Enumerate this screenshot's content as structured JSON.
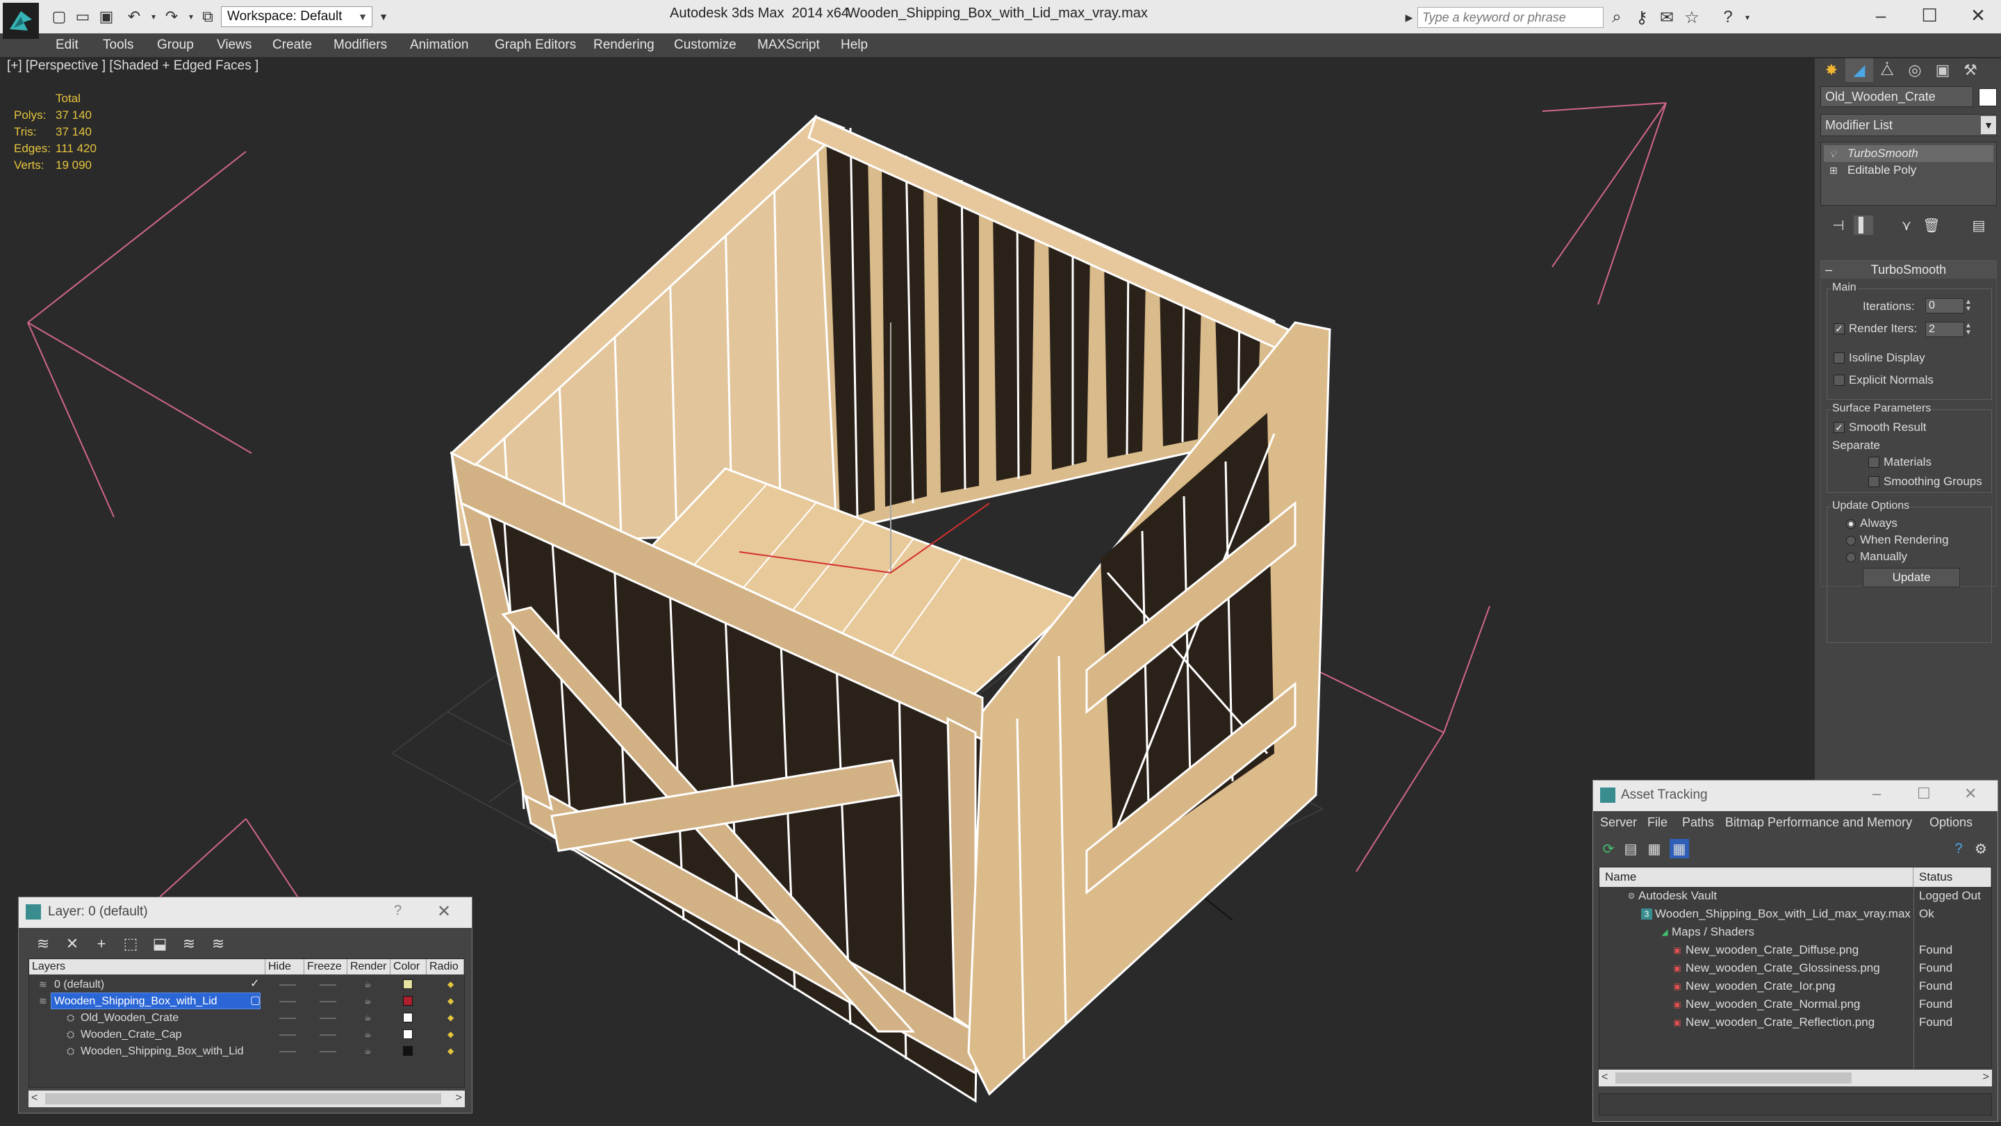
{
  "titlebar": {
    "workspace": "Workspace: Default",
    "app_title": "Autodesk 3ds Max  2014 x64",
    "file_name": "Wooden_Shipping_Box_with_Lid_max_vray.max",
    "search_placeholder": "Type a keyword or phrase"
  },
  "menu": [
    "Edit",
    "Tools",
    "Group",
    "Views",
    "Create",
    "Modifiers",
    "Animation",
    "Graph Editors",
    "Rendering",
    "Customize",
    "MAXScript",
    "Help"
  ],
  "viewport": {
    "label": "[+] [Perspective ] [Shaded + Edged Faces ]",
    "stats_header": "Total",
    "stats": [
      {
        "k": "Polys:",
        "v": "37 140"
      },
      {
        "k": "Tris:",
        "v": "37 140"
      },
      {
        "k": "Edges:",
        "v": "111 420"
      },
      {
        "k": "Verts:",
        "v": "19 090"
      }
    ]
  },
  "command_panel": {
    "object_name": "Old_Wooden_Crate",
    "modifier_list": "Modifier List",
    "stack": [
      "TurboSmooth",
      "Editable Poly"
    ],
    "rollout_title": "TurboSmooth",
    "main_group": "Main",
    "iterations_label": "Iterations:",
    "iterations_value": "0",
    "render_iters_label": "Render Iters:",
    "render_iters_value": "2",
    "isoline_label": "Isoline Display",
    "explicit_normals_label": "Explicit Normals",
    "surface_group": "Surface Parameters",
    "smooth_result_label": "Smooth Result",
    "separate_label": "Separate",
    "materials_label": "Materials",
    "smoothing_groups_label": "Smoothing Groups",
    "update_group": "Update Options",
    "always_label": "Always",
    "when_rendering_label": "When Rendering",
    "manually_label": "Manually",
    "update_button": "Update"
  },
  "layer_dialog": {
    "title": "Layer: 0 (default)",
    "help": "?",
    "columns": [
      "Layers",
      "Hide",
      "Freeze",
      "Render",
      "Color",
      "Radio"
    ],
    "rows": [
      {
        "name": "0 (default)",
        "color": "#e8e3a0"
      },
      {
        "name": "Wooden_Shipping_Box_with_Lid",
        "color": "#b01f2e"
      },
      {
        "name": "Old_Wooden_Crate",
        "color": "#ffffff"
      },
      {
        "name": "Wooden_Crate_Cap",
        "color": "#ffffff"
      },
      {
        "name": "Wooden_Shipping_Box_with_Lid",
        "color": "#111111"
      }
    ]
  },
  "asset_dialog": {
    "title": "Asset Tracking",
    "menu": [
      "Server",
      "File",
      "Paths",
      "Bitmap Performance and Memory",
      "Options"
    ],
    "columns": [
      "Name",
      "Status"
    ],
    "rows": [
      {
        "name": "Autodesk Vault",
        "status": "Logged Out"
      },
      {
        "name": "Wooden_Shipping_Box_with_Lid_max_vray.max",
        "status": "Ok"
      },
      {
        "name": "Maps / Shaders",
        "status": ""
      },
      {
        "name": "New_wooden_Crate_Diffuse.png",
        "status": "Found"
      },
      {
        "name": "New_wooden_Crate_Glossiness.png",
        "status": "Found"
      },
      {
        "name": "New_wooden_Crate_Ior.png",
        "status": "Found"
      },
      {
        "name": "New_wooden_Crate_Normal.png",
        "status": "Found"
      },
      {
        "name": "New_wooden_Crate_Reflection.png",
        "status": "Found"
      }
    ]
  },
  "colors": {
    "accent_blue": "#2b66d6",
    "stats_yellow": "#e5c53d",
    "wood": "#d8b88a",
    "wire": "#ffffff"
  }
}
